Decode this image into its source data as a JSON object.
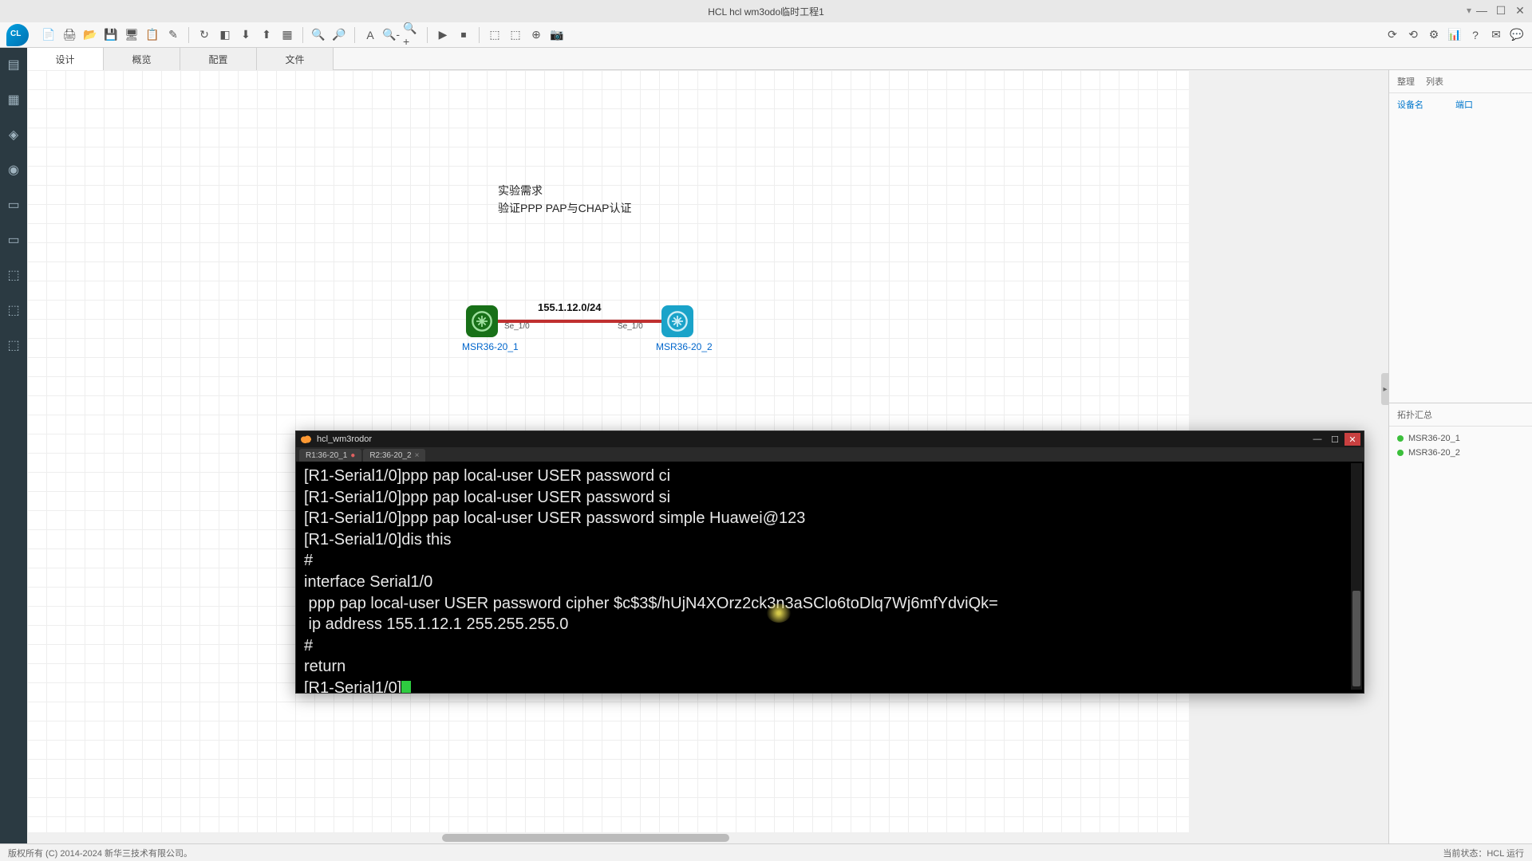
{
  "window": {
    "title": "HCL  hcl  wm3odo临时工程1"
  },
  "toolbar_icons": [
    "📄",
    "🖨",
    "📂",
    "💾",
    "🖥",
    "📋",
    "✎",
    "↻",
    "◧",
    "⬇",
    "⬆",
    "▦",
    "🔍",
    "🔎",
    "A",
    "🔍-",
    "🔍+",
    "▶",
    "⏹",
    "⬚",
    "⬚",
    "⊕",
    "📷"
  ],
  "toolbar_right": [
    "⟳",
    "⟲",
    "⚙",
    "📊",
    "?",
    "✉",
    "💬"
  ],
  "leftbar_icons": [
    "▤",
    "▦",
    "◈",
    "◉",
    "▭",
    "▭",
    "⬚",
    "⬚",
    "⬚"
  ],
  "tabs": [
    {
      "label": "设计",
      "active": true
    },
    {
      "label": "概览",
      "active": false
    },
    {
      "label": "配置",
      "active": false
    },
    {
      "label": "文件",
      "active": false
    }
  ],
  "topology": {
    "note_line1": "实验需求",
    "note_line2": "验证PPP PAP与CHAP认证",
    "router1_label": "MSR36-20_1",
    "router2_label": "MSR36-20_2",
    "link_label": "155.1.12.0/24",
    "port1": "Se_1/0",
    "port2": "Se_1/0"
  },
  "terminal": {
    "title": "hcl_wm3rodor",
    "tab1": "R1:36-20_1",
    "tab2": "R2:36-20_2",
    "lines": [
      "[R1-Serial1/0]ppp pap local-user USER password ci",
      "[R1-Serial1/0]ppp pap local-user USER password si",
      "[R1-Serial1/0]ppp pap local-user USER password simple Huawei@123",
      "[R1-Serial1/0]dis this",
      "#",
      "interface Serial1/0",
      " ppp pap local-user USER password cipher $c$3$/hUjN4XOrz2ck3n3aSClo6toDlq7Wj6mfYdviQk=",
      " ip address 155.1.12.1 255.255.255.0",
      "#",
      "return",
      "[R1-Serial1/0]"
    ]
  },
  "rightpanel": {
    "hdr1": "整理",
    "hdr2": "列表",
    "sub1": "设备名",
    "sub2": "端口",
    "sect2_title": "拓扑汇总",
    "devices": [
      "MSR36-20_1",
      "MSR36-20_2"
    ]
  },
  "statusbar": {
    "left": "版权所有 (C) 2014-2024 新华三技术有限公司。",
    "right": "当前状态：HCL 运行"
  }
}
